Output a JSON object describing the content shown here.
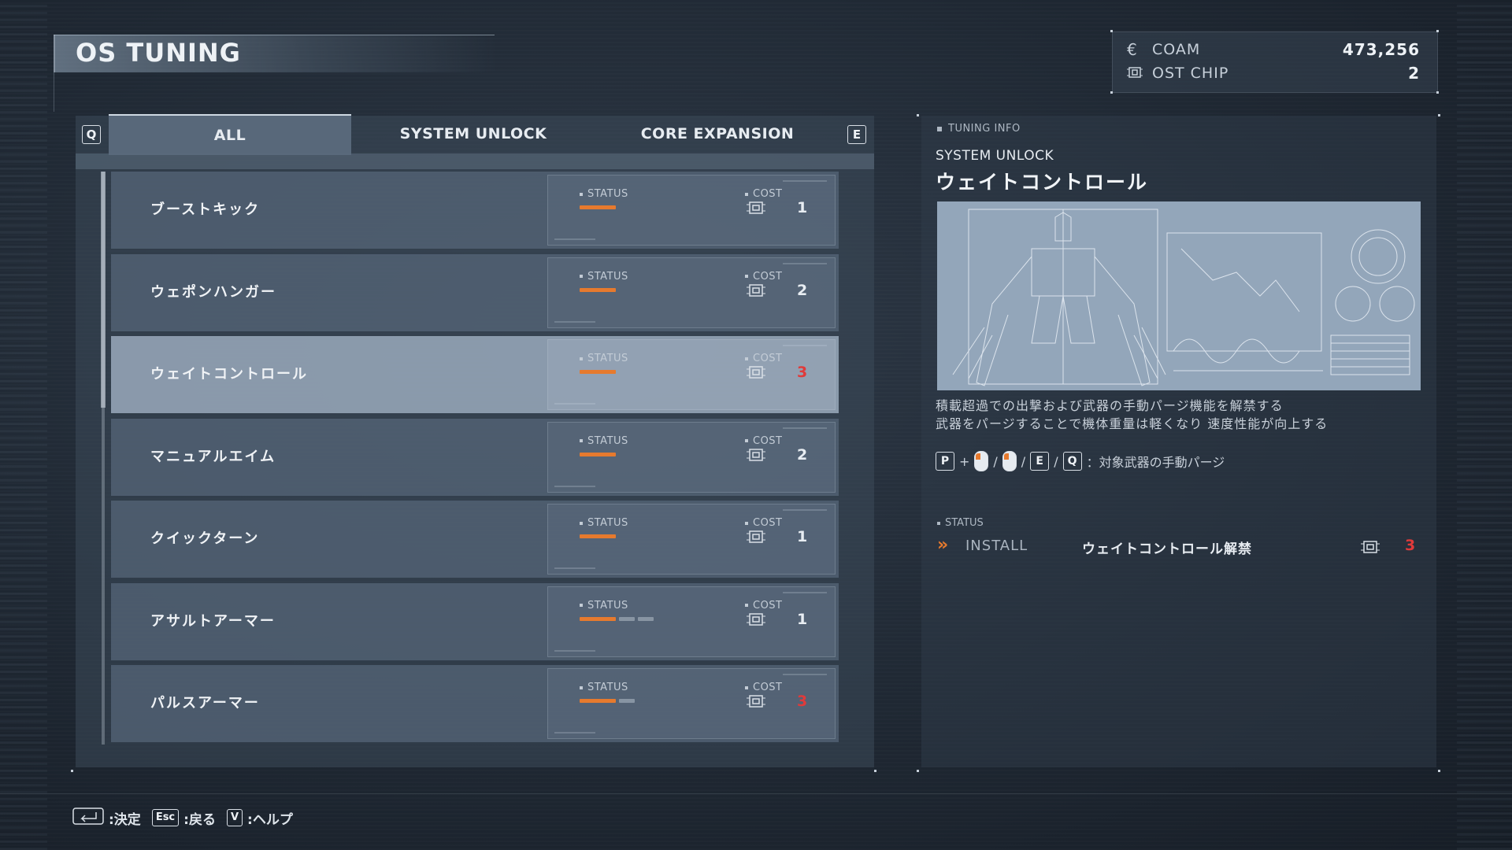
{
  "header": {
    "title": "OS TUNING"
  },
  "currency": [
    {
      "icon": "coam-currency-icon",
      "label": "COAM",
      "value": "473,256"
    },
    {
      "icon": "ost-chip-icon",
      "label": "OST CHIP",
      "value": "2"
    }
  ],
  "tabs": {
    "prev_key": "Q",
    "next_key": "E",
    "items": [
      {
        "label": "ALL",
        "active": true
      },
      {
        "label": "SYSTEM UNLOCK",
        "active": false
      },
      {
        "label": "CORE EXPANSION",
        "active": false
      }
    ]
  },
  "list": {
    "status_label": "STATUS",
    "cost_label": "COST",
    "items": [
      {
        "name": "ブーストキック",
        "status_on": 1,
        "status_total": 1,
        "cost": "1",
        "cost_red": false,
        "selected": false
      },
      {
        "name": "ウェポンハンガー",
        "status_on": 1,
        "status_total": 1,
        "cost": "2",
        "cost_red": false,
        "selected": false
      },
      {
        "name": "ウェイトコントロール",
        "status_on": 1,
        "status_total": 1,
        "cost": "3",
        "cost_red": true,
        "selected": true
      },
      {
        "name": "マニュアルエイム",
        "status_on": 1,
        "status_total": 1,
        "cost": "2",
        "cost_red": false,
        "selected": false
      },
      {
        "name": "クイックターン",
        "status_on": 1,
        "status_total": 1,
        "cost": "1",
        "cost_red": false,
        "selected": false
      },
      {
        "name": "アサルトアーマー",
        "status_on": 1,
        "status_total": 3,
        "cost": "1",
        "cost_red": false,
        "selected": false
      },
      {
        "name": "パルスアーマー",
        "status_on": 1,
        "status_total": 2,
        "cost": "3",
        "cost_red": true,
        "selected": false
      }
    ]
  },
  "detail": {
    "section_label": "TUNING INFO",
    "category": "SYSTEM UNLOCK",
    "title": "ウェイトコントロール",
    "description_1": "積載超過での出撃および武器の手動パージ機能を解禁する",
    "description_2": "武器をパージすることで機体重量は軽くなり 速度性能が向上する",
    "controls": {
      "key_p": "P",
      "plus": "+",
      "sep": "/",
      "key_e": "E",
      "key_q": "Q",
      "action": "：対象武器の手動パージ"
    },
    "status_label": "STATUS",
    "install": {
      "label": "INSTALL",
      "name": "ウェイトコントロール解禁",
      "cost": "3"
    }
  },
  "footer": {
    "confirm": ":決定",
    "esc_key": "Esc",
    "back": ":戻る",
    "help_key": "V",
    "help": ":ヘルプ"
  },
  "colors": {
    "accent": "#e67a2e",
    "warn": "#e03a3a"
  }
}
